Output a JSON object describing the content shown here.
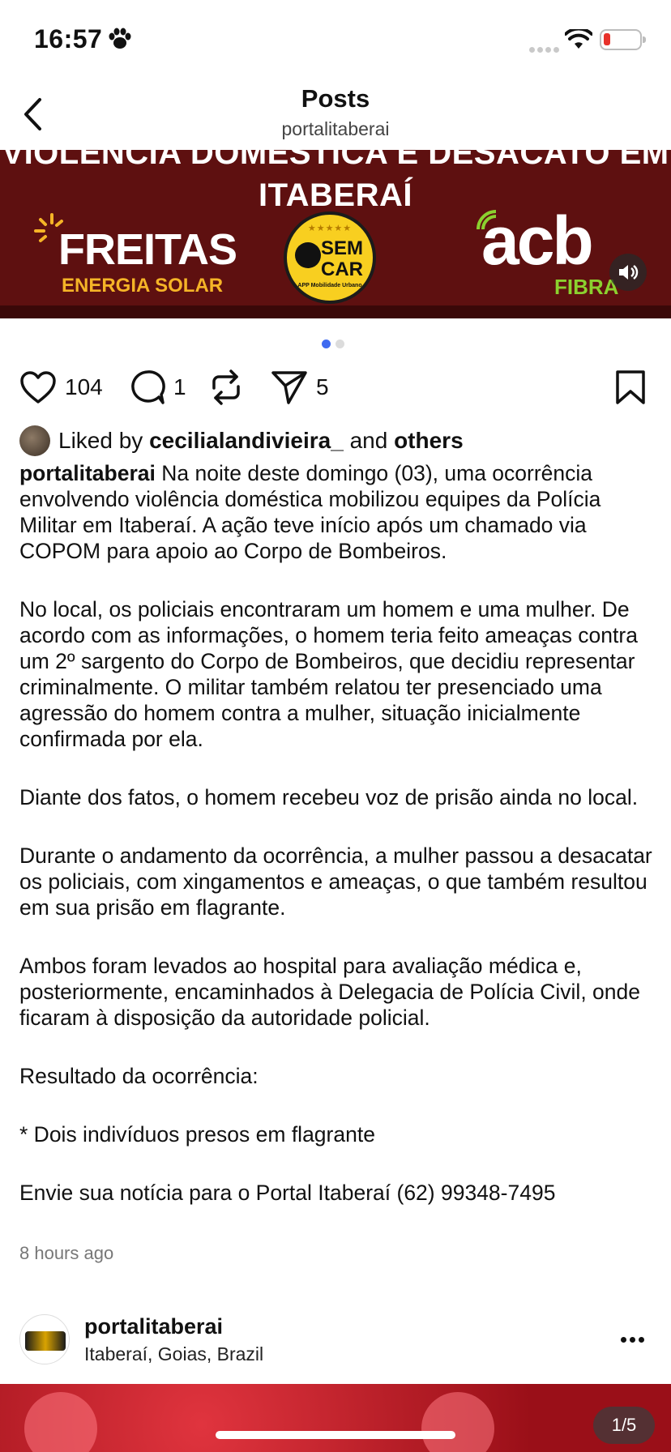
{
  "status_bar": {
    "time": "16:57"
  },
  "header": {
    "title": "Posts",
    "subtitle": "portalitaberai"
  },
  "media": {
    "headline_line1": "VIOLÊNCIA DOMÉSTICA E DESACATO EM",
    "headline_line2": "ITABERAÍ",
    "sponsors": {
      "freitas_name": "FREITAS",
      "freitas_tag": "ENERGIA SOLAR",
      "semcar_line1": "SEM",
      "semcar_line2": "CAR",
      "semcar_sub": "APP Mobilidade Urbano",
      "acb_name": "acb",
      "acb_tag": "FIBRA"
    }
  },
  "actions": {
    "likes": "104",
    "comments": "1",
    "shares": "5"
  },
  "liked_by": {
    "prefix": "Liked by",
    "user": "cecilialandivieira_",
    "middle": "and",
    "suffix": "others"
  },
  "post": {
    "username": "portalitaberai",
    "paragraphs": [
      "Na noite deste domingo (03), uma ocorrência envolvendo violência doméstica mobilizou equipes da Polícia Militar em Itaberaí. A ação teve início após um chamado via COPOM para apoio ao Corpo de Bombeiros.",
      "No local, os policiais encontraram um homem e uma mulher. De acordo com as informações, o homem teria feito ameaças contra um 2º sargento do Corpo de Bombeiros, que decidiu representar criminalmente. O militar também relatou ter presenciado uma agressão do homem contra a mulher, situação inicialmente confirmada por ela.",
      "Diante dos fatos, o homem recebeu voz de prisão ainda no local.",
      "Durante o andamento da ocorrência, a mulher passou a desacatar os policiais, com xingamentos e ameaças, o que também resultou em sua prisão em flagrante.",
      "Ambos foram levados ao hospital para avaliação médica e, posteriormente, encaminhados à Delegacia de Polícia Civil, onde ficaram à disposição da autoridade policial.",
      "Resultado da ocorrência:",
      "* Dois indivíduos presos em flagrante",
      "Envie sua notícia para o Portal Itaberaí (62) 99348-7495"
    ],
    "time_ago": "8 hours ago"
  },
  "next_post": {
    "username": "portalitaberai",
    "location": "Itaberaí, Goias, Brazil",
    "counter": "1/5"
  },
  "colors": {
    "accent": "#3f6af0",
    "banner": "#5e1010",
    "semcar": "#f8cf20",
    "acb_green": "#8bd12f",
    "freitas_gold": "#f5b427"
  }
}
